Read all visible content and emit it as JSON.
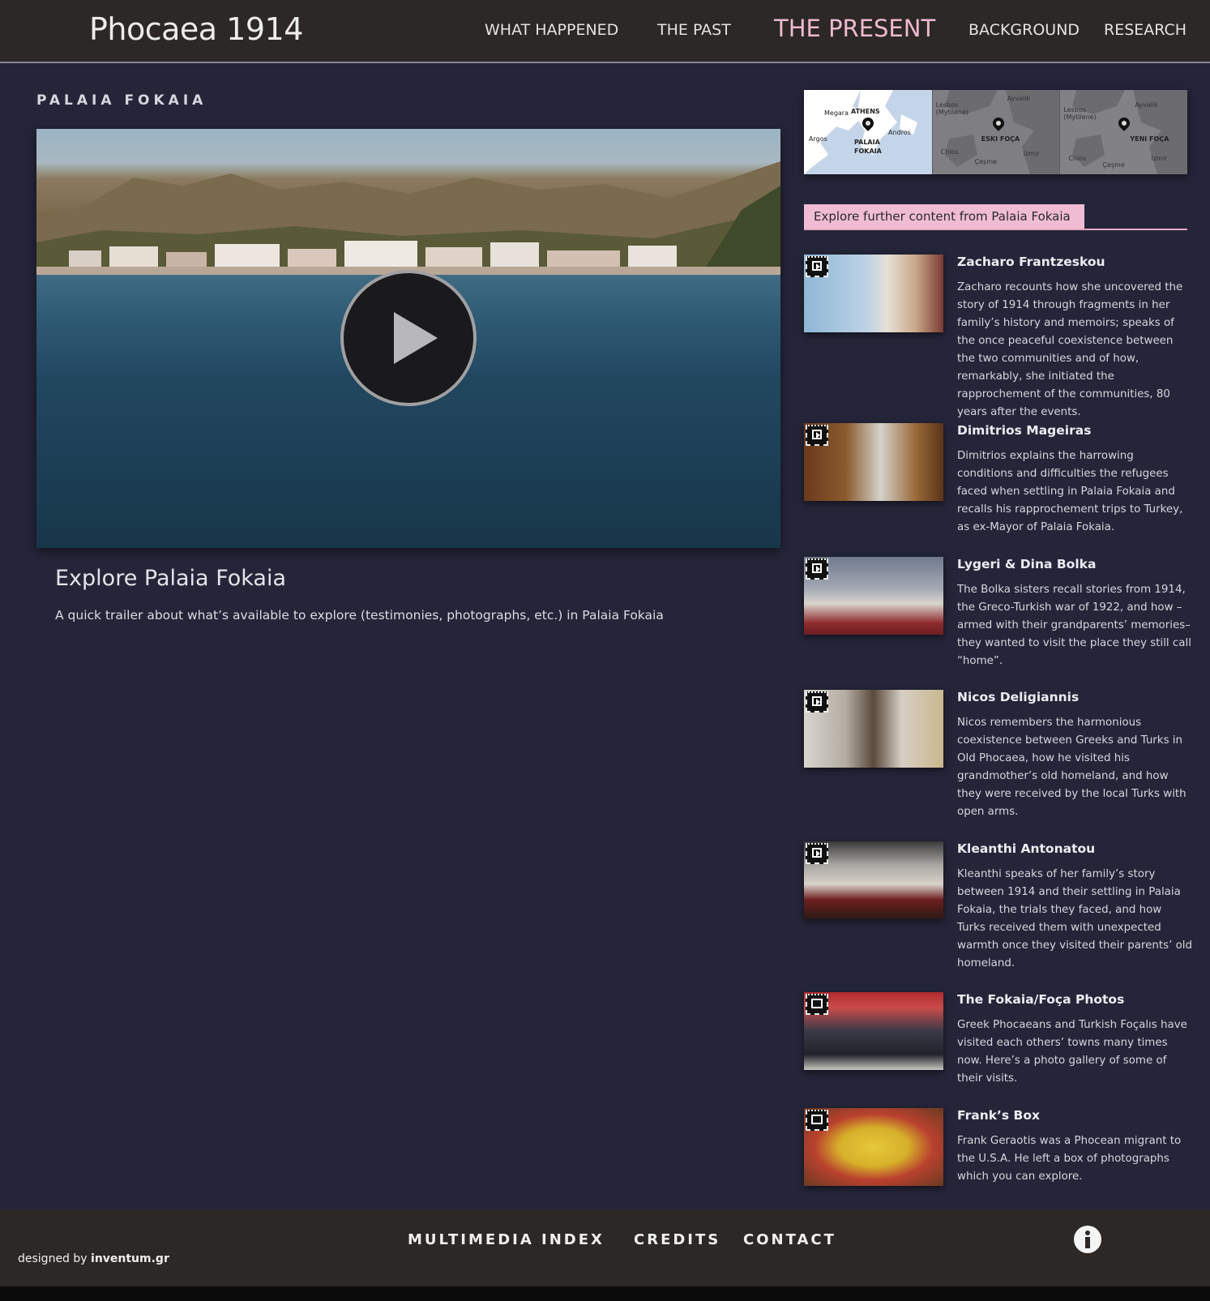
{
  "header": {
    "site_title": "Phocaea 1914",
    "nav": [
      {
        "label": "WHAT HAPPENED",
        "active": false
      },
      {
        "label": "THE PAST",
        "active": false
      },
      {
        "label": "THE PRESENT",
        "active": true
      },
      {
        "label": "BACKGROUND",
        "active": false
      },
      {
        "label": "RESEARCH",
        "active": false
      }
    ]
  },
  "main": {
    "section_label": "PALAIA FOKAIA",
    "video": {
      "title": "Explore Palaia Fokaia",
      "description": "A quick trailer about what’s available to explore (testimonies, photographs, etc.) in Palaia Fokaia",
      "play_icon": "play-icon"
    }
  },
  "maps": {
    "tile1": {
      "labels": [
        "ATHENS",
        "PALAIA",
        "FOKAIA",
        "Megara",
        "Argos",
        "Andros"
      ]
    },
    "tile2": {
      "labels": [
        "ESKI FOÇA",
        "Ayvalik",
        "Izmir",
        "Chios",
        "Çeşme",
        "Lesbos (Mytilene)"
      ]
    },
    "tile3": {
      "labels": [
        "YENI FOÇA",
        "Ayvalik",
        "Izmir",
        "Chios",
        "Çeşme",
        "Lesbos (Mytilene)"
      ]
    }
  },
  "sidebar": {
    "explore_label": "Explore further content from Palaia Fokaia",
    "items": [
      {
        "type": "video",
        "title": "Zacharo Frantzeskou",
        "text": "Zacharo recounts how she uncovered the story of 1914 through fragments in her family’s history and memoirs; speaks of the once peaceful coexistence between the two communities and of how, remarkably, she initiated the rapprochement of the communities, 80 years after the events."
      },
      {
        "type": "video",
        "title": "Dimitrios Mageiras",
        "text": "Dimitrios explains the harrowing conditions and difficulties the refugees faced when settling in Palaia Fokaia and recalls his rapprochement trips to Turkey, as ex-Mayor of Palaia Fokaia."
      },
      {
        "type": "video",
        "title": "Lygeri & Dina Bolka",
        "text": "The Bolka sisters recall stories from 1914, the Greco-Turkish war of 1922, and how – armed with their grandparents’ memories– they wanted to visit the place they still call “home”."
      },
      {
        "type": "video",
        "title": "Nicos Deligiannis",
        "text": "Nicos remembers the harmonious coexistence between Greeks and Turks in Old Phocaea, how he visited his grandmother’s old homeland, and how they were received by the local Turks with open arms."
      },
      {
        "type": "video",
        "title": "Kleanthi Antonatou",
        "text": "Kleanthi speaks of her family’s story between 1914 and their settling in Palaia Fokaia, the trials they faced, and how Turks received them with unexpected warmth once they visited their parents’ old homeland."
      },
      {
        "type": "gallery",
        "title": "The Fokaia/Foça Photos",
        "text": "Greek Phocaeans and Turkish Foçalıs have visited each others’ towns many times now. Here’s a photo gallery of some of their visits."
      },
      {
        "type": "gallery",
        "title": "Frank’s Box",
        "text": "Frank Geraotis was a Phocean migrant to the U.S.A. He left a box of photographs which you can explore."
      }
    ]
  },
  "footer": {
    "links": [
      "MULTIMEDIA INDEX",
      "CREDITS",
      "CONTACT"
    ],
    "designed_prefix": "designed by ",
    "designed_by": "inventum.gr",
    "info_icon": "info-icon"
  },
  "colors": {
    "background": "#25253a",
    "header": "#2b2826",
    "accent_pink": "#f0bcd3"
  }
}
